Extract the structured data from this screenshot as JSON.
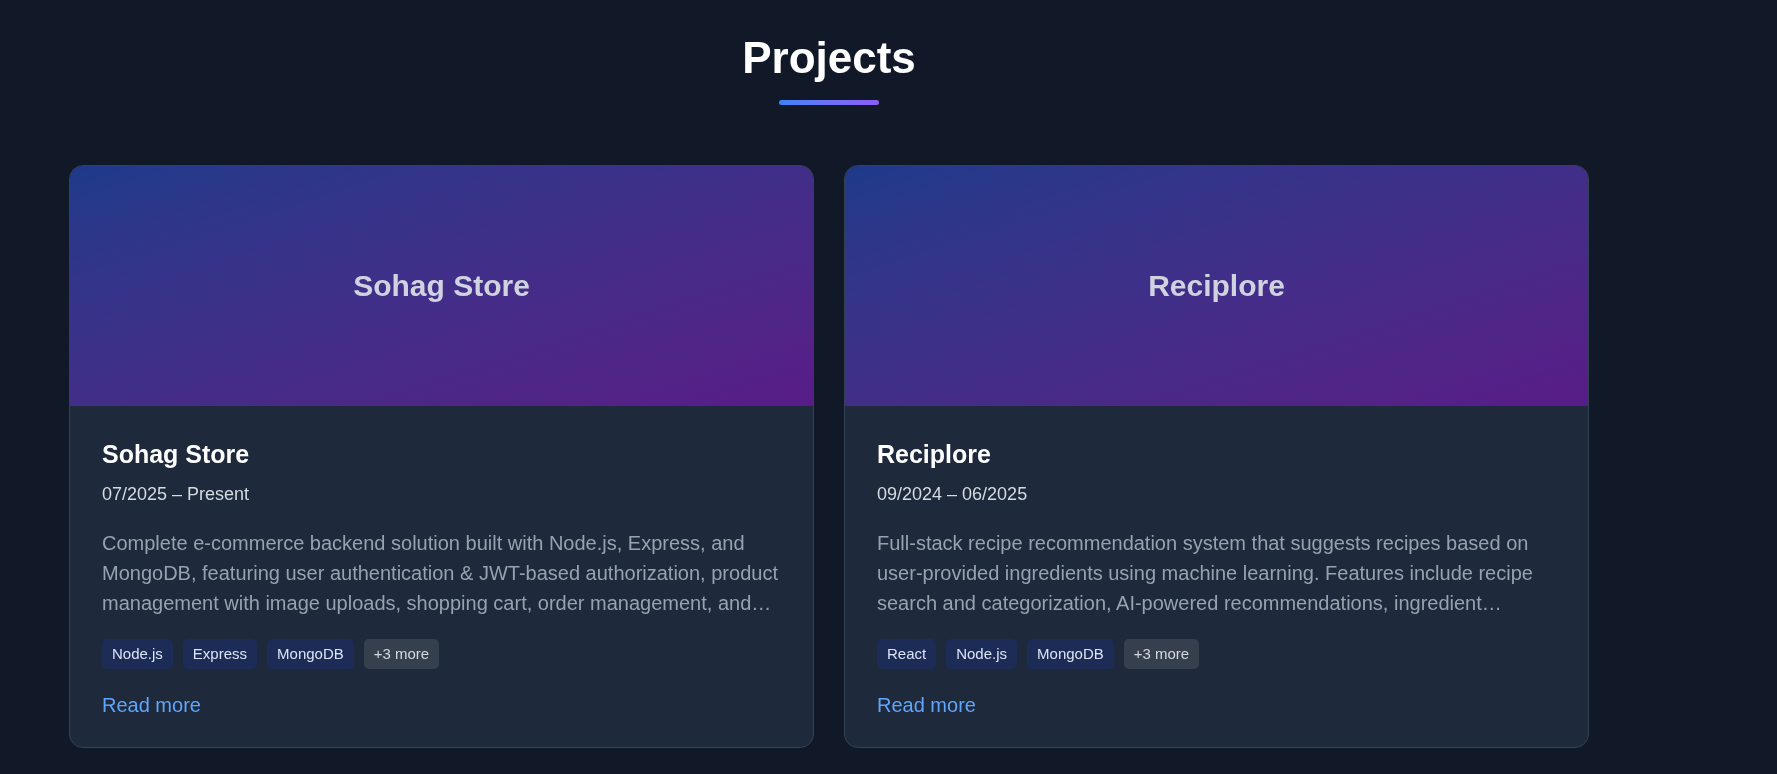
{
  "section": {
    "title": "Projects"
  },
  "projects": [
    {
      "banner_title": "Sohag Store",
      "title": "Sohag Store",
      "dates": "07/2025 – Present",
      "description": "Complete e-commerce backend solution built with Node.js, Express, and MongoDB, featuring user authentication & JWT-based authorization, product management with image uploads, shopping cart, order management, and…",
      "tags": [
        {
          "label": "Node.js",
          "kind": "tech"
        },
        {
          "label": "Express",
          "kind": "tech"
        },
        {
          "label": "MongoDB",
          "kind": "tech"
        },
        {
          "label": "+3 more",
          "kind": "more"
        }
      ],
      "link": "Read more"
    },
    {
      "banner_title": "Reciplore",
      "title": "Reciplore",
      "dates": "09/2024 – 06/2025",
      "description": "Full-stack recipe recommendation system that suggests recipes based on user-provided ingredients using machine learning. Features include recipe search and categorization, AI-powered recommendations, ingredient…",
      "tags": [
        {
          "label": "React",
          "kind": "tech"
        },
        {
          "label": "Node.js",
          "kind": "tech"
        },
        {
          "label": "MongoDB",
          "kind": "tech"
        },
        {
          "label": "+3 more",
          "kind": "more"
        }
      ],
      "link": "Read more"
    }
  ]
}
